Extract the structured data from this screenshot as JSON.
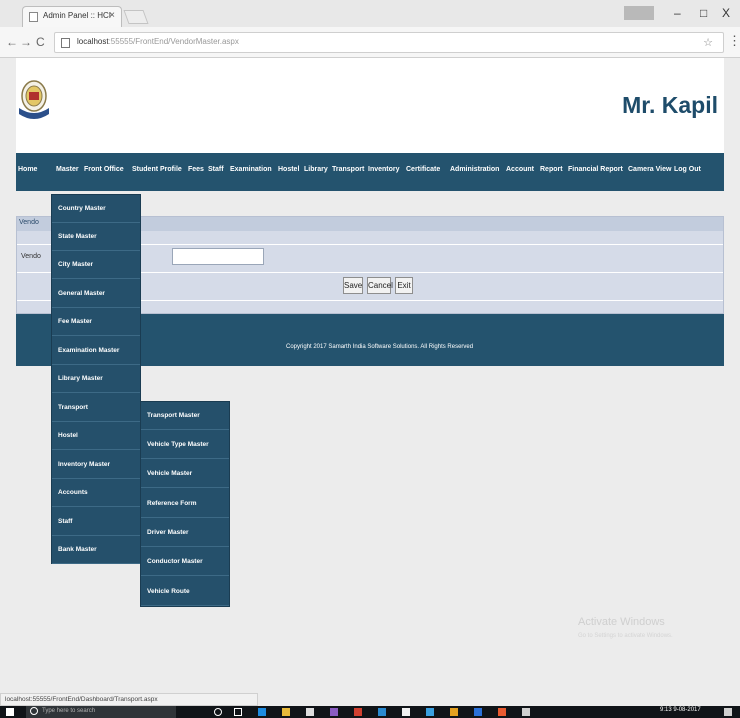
{
  "browser": {
    "tab_title": "Admin Panel :: HCI",
    "tab_close": "×",
    "window_controls": [
      "–",
      "□",
      "X"
    ],
    "url_host": "localhost",
    "url_path": ":55555/FrontEnd/VendorMaster.aspx",
    "nav_back": "←",
    "nav_forward": "→",
    "nav_reload": "C"
  },
  "header": {
    "user_name": "Mr. Kapil"
  },
  "nav": {
    "items": [
      "Home",
      "Master",
      "Front Office",
      "Student Profile",
      "Fees",
      "Staff",
      "Examination",
      "Hostel",
      "Library",
      "Transport",
      "Inventory",
      "Certificate",
      "Administration",
      "Account",
      "Report",
      "Financial Report",
      "Camera View",
      "Log Out"
    ]
  },
  "panel": {
    "title": "Vendo",
    "field_label": "Vendo",
    "input_value": "",
    "buttons": {
      "save": "Save",
      "cancel": "Cancel",
      "exit": "Exit"
    }
  },
  "footer": {
    "copyright": "Copyright 2017 Samarth India Software Solutions. All Rights Reserved"
  },
  "master_menu": [
    "Country Master",
    "State Master",
    "City Master",
    "General Master",
    "Fee Master",
    "Examination Master",
    "Library Master",
    "Transport",
    "Hostel",
    "Inventory Master",
    "Accounts",
    "Staff",
    "Bank Master"
  ],
  "transport_submenu": [
    "Transport Master",
    "Vehicle Type Master",
    "Vehicle Master",
    "Reference Form",
    "Driver Master",
    "Conductor Master",
    "Vehicle Route"
  ],
  "watermark": {
    "title": "Activate Windows",
    "subtitle": "Go to Settings to activate Windows."
  },
  "status_bar": {
    "url": "localhost:55555/FrontEnd/Dashboard/Transport.aspx"
  },
  "taskbar": {
    "search_placeholder": "Type here to search",
    "tray_time": "9:13",
    "tray_date": "9-08-2017"
  },
  "colors": {
    "navbar": "#24536e",
    "panel": "#d5dbe8",
    "user_name": "#1e4c6a",
    "menu_bg": "#25506b"
  }
}
